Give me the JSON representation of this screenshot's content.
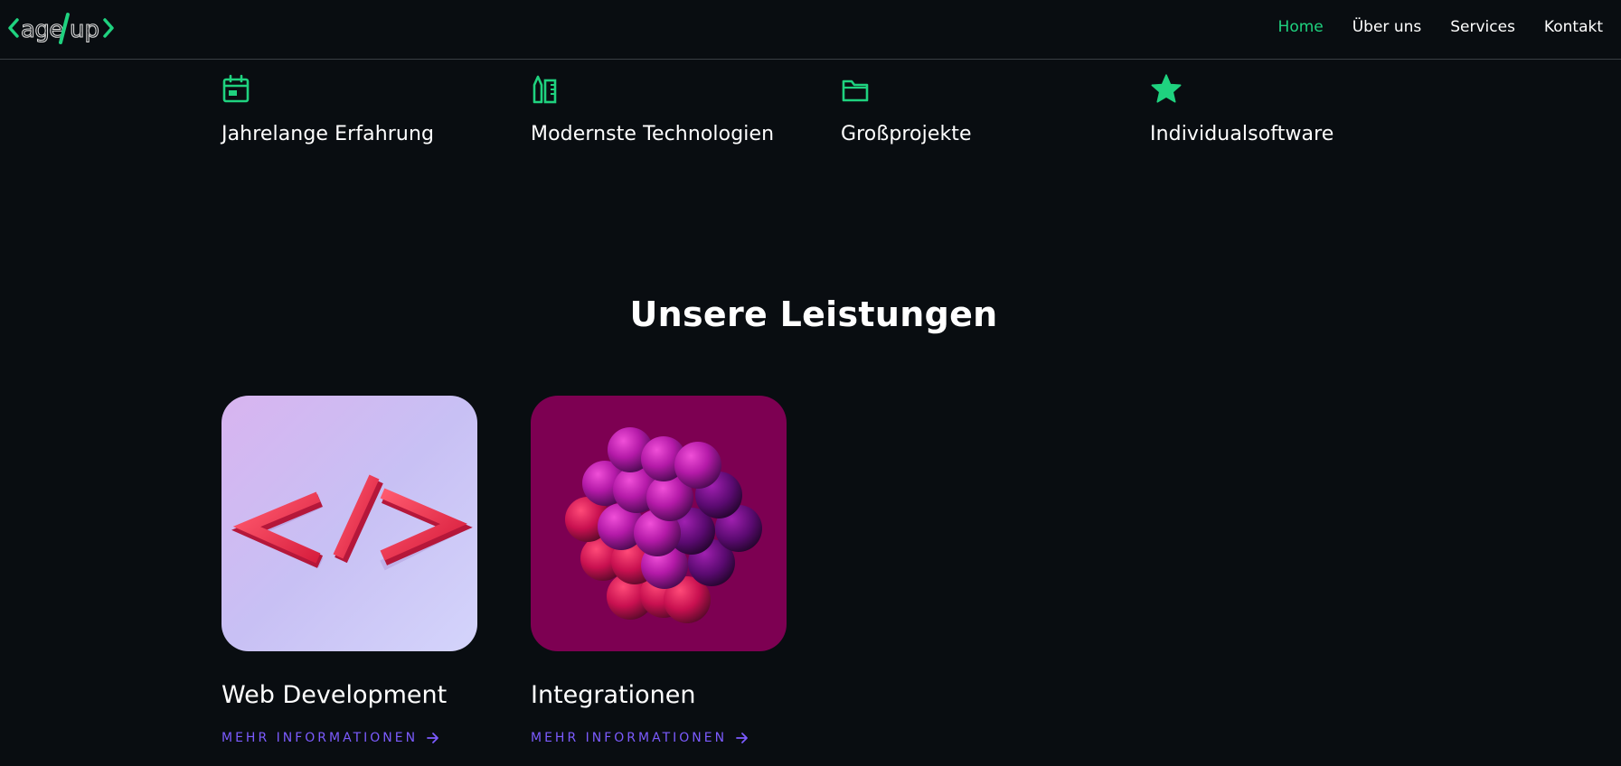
{
  "header": {
    "logo_text": "<age/up>",
    "nav": [
      {
        "label": "Home",
        "active": true
      },
      {
        "label": "Über uns",
        "active": false
      },
      {
        "label": "Services",
        "active": false
      },
      {
        "label": "Kontakt",
        "active": false
      }
    ]
  },
  "features": [
    {
      "icon": "calendar-icon",
      "title": "Jahrelange Erfahrung"
    },
    {
      "icon": "tools-icon",
      "title": "Modernste Technologien"
    },
    {
      "icon": "folder-icon",
      "title": "Großprojekte"
    },
    {
      "icon": "star-icon",
      "title": "Individualsoftware"
    }
  ],
  "services": {
    "title": "Unsere Leistungen",
    "cards": [
      {
        "title": "Web Development",
        "link_label": "MEHR INFORMATIONEN",
        "image": "code-brackets-image"
      },
      {
        "title": "Integrationen",
        "link_label": "MEHR INFORMATIONEN",
        "image": "spheres-cluster-image"
      }
    ]
  },
  "colors": {
    "background": "#090d11",
    "accent_green": "#1fd27f",
    "link_purple": "#7c5bff",
    "text": "#ffffff"
  }
}
